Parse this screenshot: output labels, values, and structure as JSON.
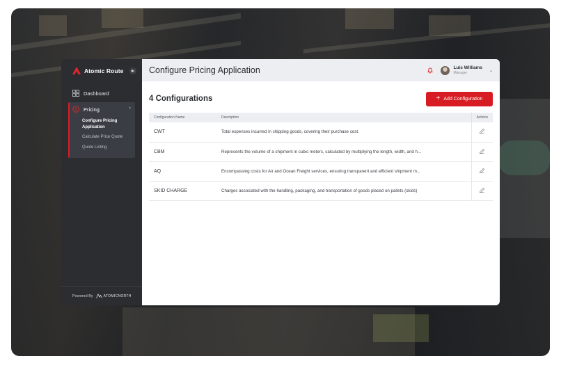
{
  "sidebar": {
    "brand": "Atomic Route",
    "nav": [
      {
        "label": "Dashboard",
        "icon": "grid-icon"
      }
    ],
    "pricing": {
      "label": "Pricing",
      "icon": "dollar-circle-icon",
      "items": [
        {
          "label": "Configure Pricing Application",
          "active": true
        },
        {
          "label": "Calculate Price Quote",
          "active": false
        },
        {
          "label": "Quote Listing",
          "active": false
        }
      ]
    },
    "footer": {
      "powered_by": "Powered By",
      "company": "ATOMICNORTH"
    }
  },
  "header": {
    "title": "Configure Pricing Application",
    "user": {
      "name": "Luis Williams",
      "role": "Manager"
    }
  },
  "content": {
    "count_title": "4 Configurations",
    "add_button": "Add Configuration",
    "table": {
      "columns": [
        "Configuration Name",
        "Description",
        "Actions"
      ],
      "rows": [
        {
          "name": "CWT",
          "description": "Total expenses incurred in shipping goods, covering their purchase cost."
        },
        {
          "name": "CBM",
          "description": "Represents the volume of a shipment in cubic meters, calculated by multiplying the length, width, and h..."
        },
        {
          "name": "AQ",
          "description": "Encompassing costs for Air and Ocean Freight services, ensuring transparent and efficient shipment m..."
        },
        {
          "name": "SKID CHARGE",
          "description": "Charges associated with the handling, packaging, and transportation of goods placed on pallets (skids)"
        }
      ]
    }
  },
  "colors": {
    "accent": "#d81c23",
    "sidebar": "#2b2d31",
    "topbar": "#eceef1"
  }
}
